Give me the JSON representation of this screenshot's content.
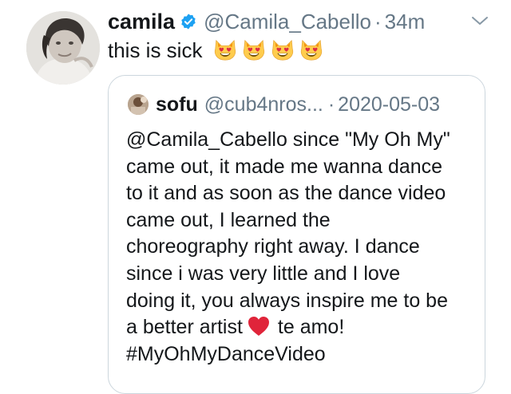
{
  "tweet": {
    "author_name": "camila",
    "verified": true,
    "handle": "@Camila_Cabello",
    "separator": "·",
    "time": "34m",
    "text": "this is sick",
    "emoji": [
      "smiling-cat-heart-eyes-emoji",
      "smiling-cat-heart-eyes-emoji",
      "smiling-cat-heart-eyes-emoji",
      "smiling-cat-heart-eyes-emoji"
    ],
    "menu_icon": "chevron-down-icon"
  },
  "quote": {
    "author_name": "sofu",
    "handle": "@cub4nros...",
    "separator": "·",
    "date": "2020-05-03",
    "lines": [
      "@Camila_Cabello since \"My Oh My\"",
      "came out, it made me wanna dance",
      "to it and as soon as the dance video",
      "came out, I learned the",
      "choreography right away. I dance",
      "since i was very little and I love",
      "doing it, you always inspire me to be"
    ],
    "line_heart_before": "a better artist",
    "line_heart_after": "te amo!",
    "hashtag": "#MyOhMyDanceVideo"
  },
  "colors": {
    "text": "#14171a",
    "secondary": "#657786",
    "verified_blue": "#1da1f2",
    "card_border": "#ccd6dd",
    "heart_red": "#e0243a"
  }
}
